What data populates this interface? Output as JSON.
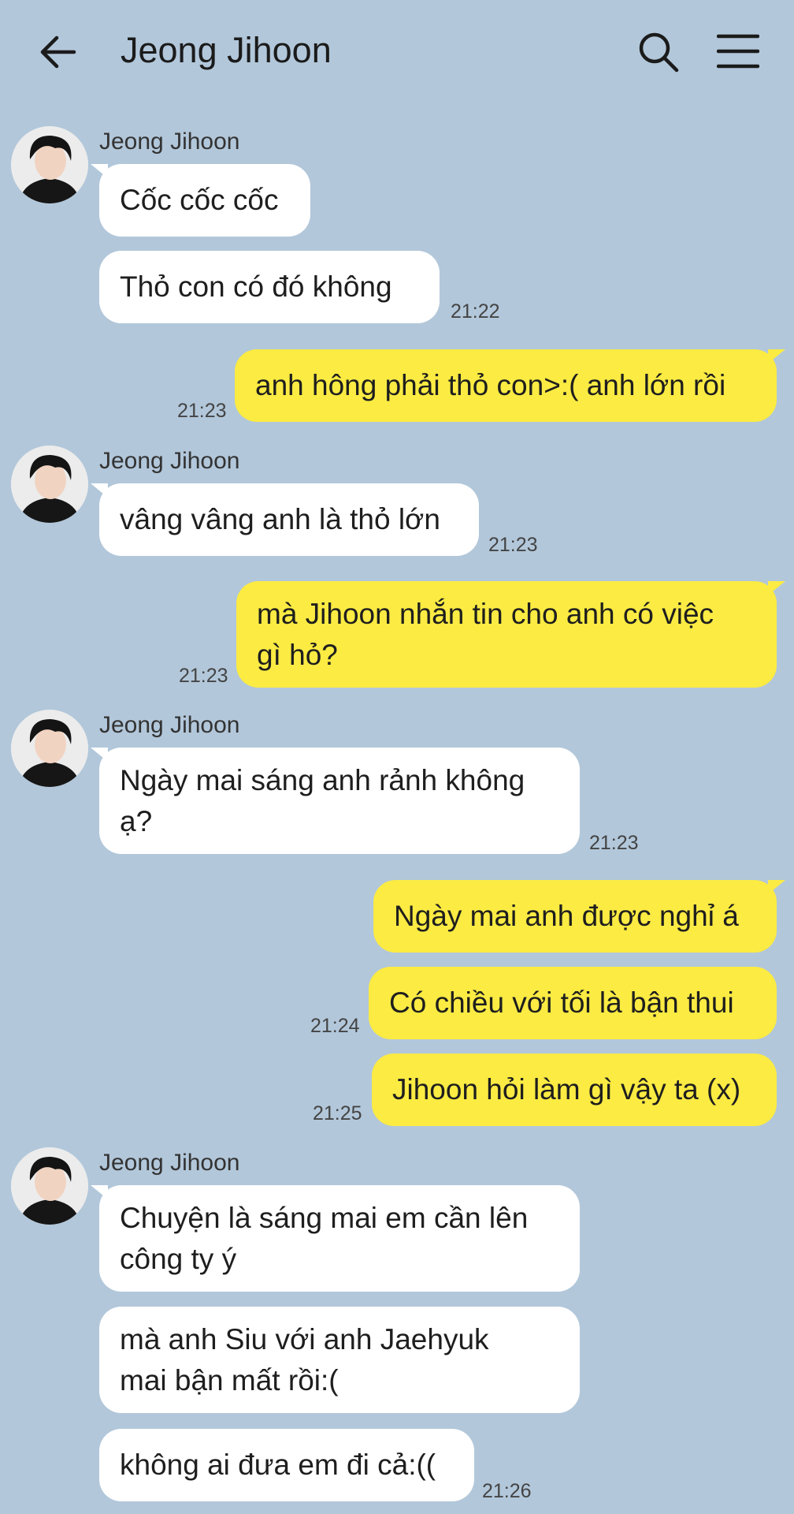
{
  "header": {
    "title": "Jeong Jihoon"
  },
  "contact": {
    "name": "Jeong Jihoon"
  },
  "messages": {
    "m1": "Cốc cốc cốc",
    "m2": "Thỏ con có đó không",
    "t1": "21:22",
    "m3": "anh hông phải thỏ con>:( anh lớn rồi",
    "t2": "21:23",
    "m4": "vâng vâng anh là thỏ lớn",
    "t3": "21:23",
    "m5a": "mà Jihoon nhắn tin cho anh có việc",
    "m5b": "gì hỏ?",
    "t4": "21:23",
    "m6a": "Ngày mai sáng anh rảnh không",
    "m6b": "ạ?",
    "t5": "21:23",
    "m7": "Ngày mai anh được nghỉ á",
    "m8": "Có chiều với tối là bận thui",
    "t6": "21:24",
    "m9": "Jihoon hỏi làm gì vậy ta (x)",
    "t7": "21:25",
    "m10a": "Chuyện là sáng mai em cần lên",
    "m10b": "công ty ý",
    "m11a": "mà anh Siu với anh Jaehyuk",
    "m11b": "mai bận mất rồi:(",
    "m12": "không ai đưa em đi cả:((",
    "t8": "21:26"
  },
  "icons": {
    "back": "back-arrow-icon",
    "search": "search-icon",
    "menu": "menu-icon"
  },
  "colors": {
    "background": "#b2c7da",
    "incoming_bubble": "#ffffff",
    "outgoing_bubble": "#fbeb43"
  }
}
